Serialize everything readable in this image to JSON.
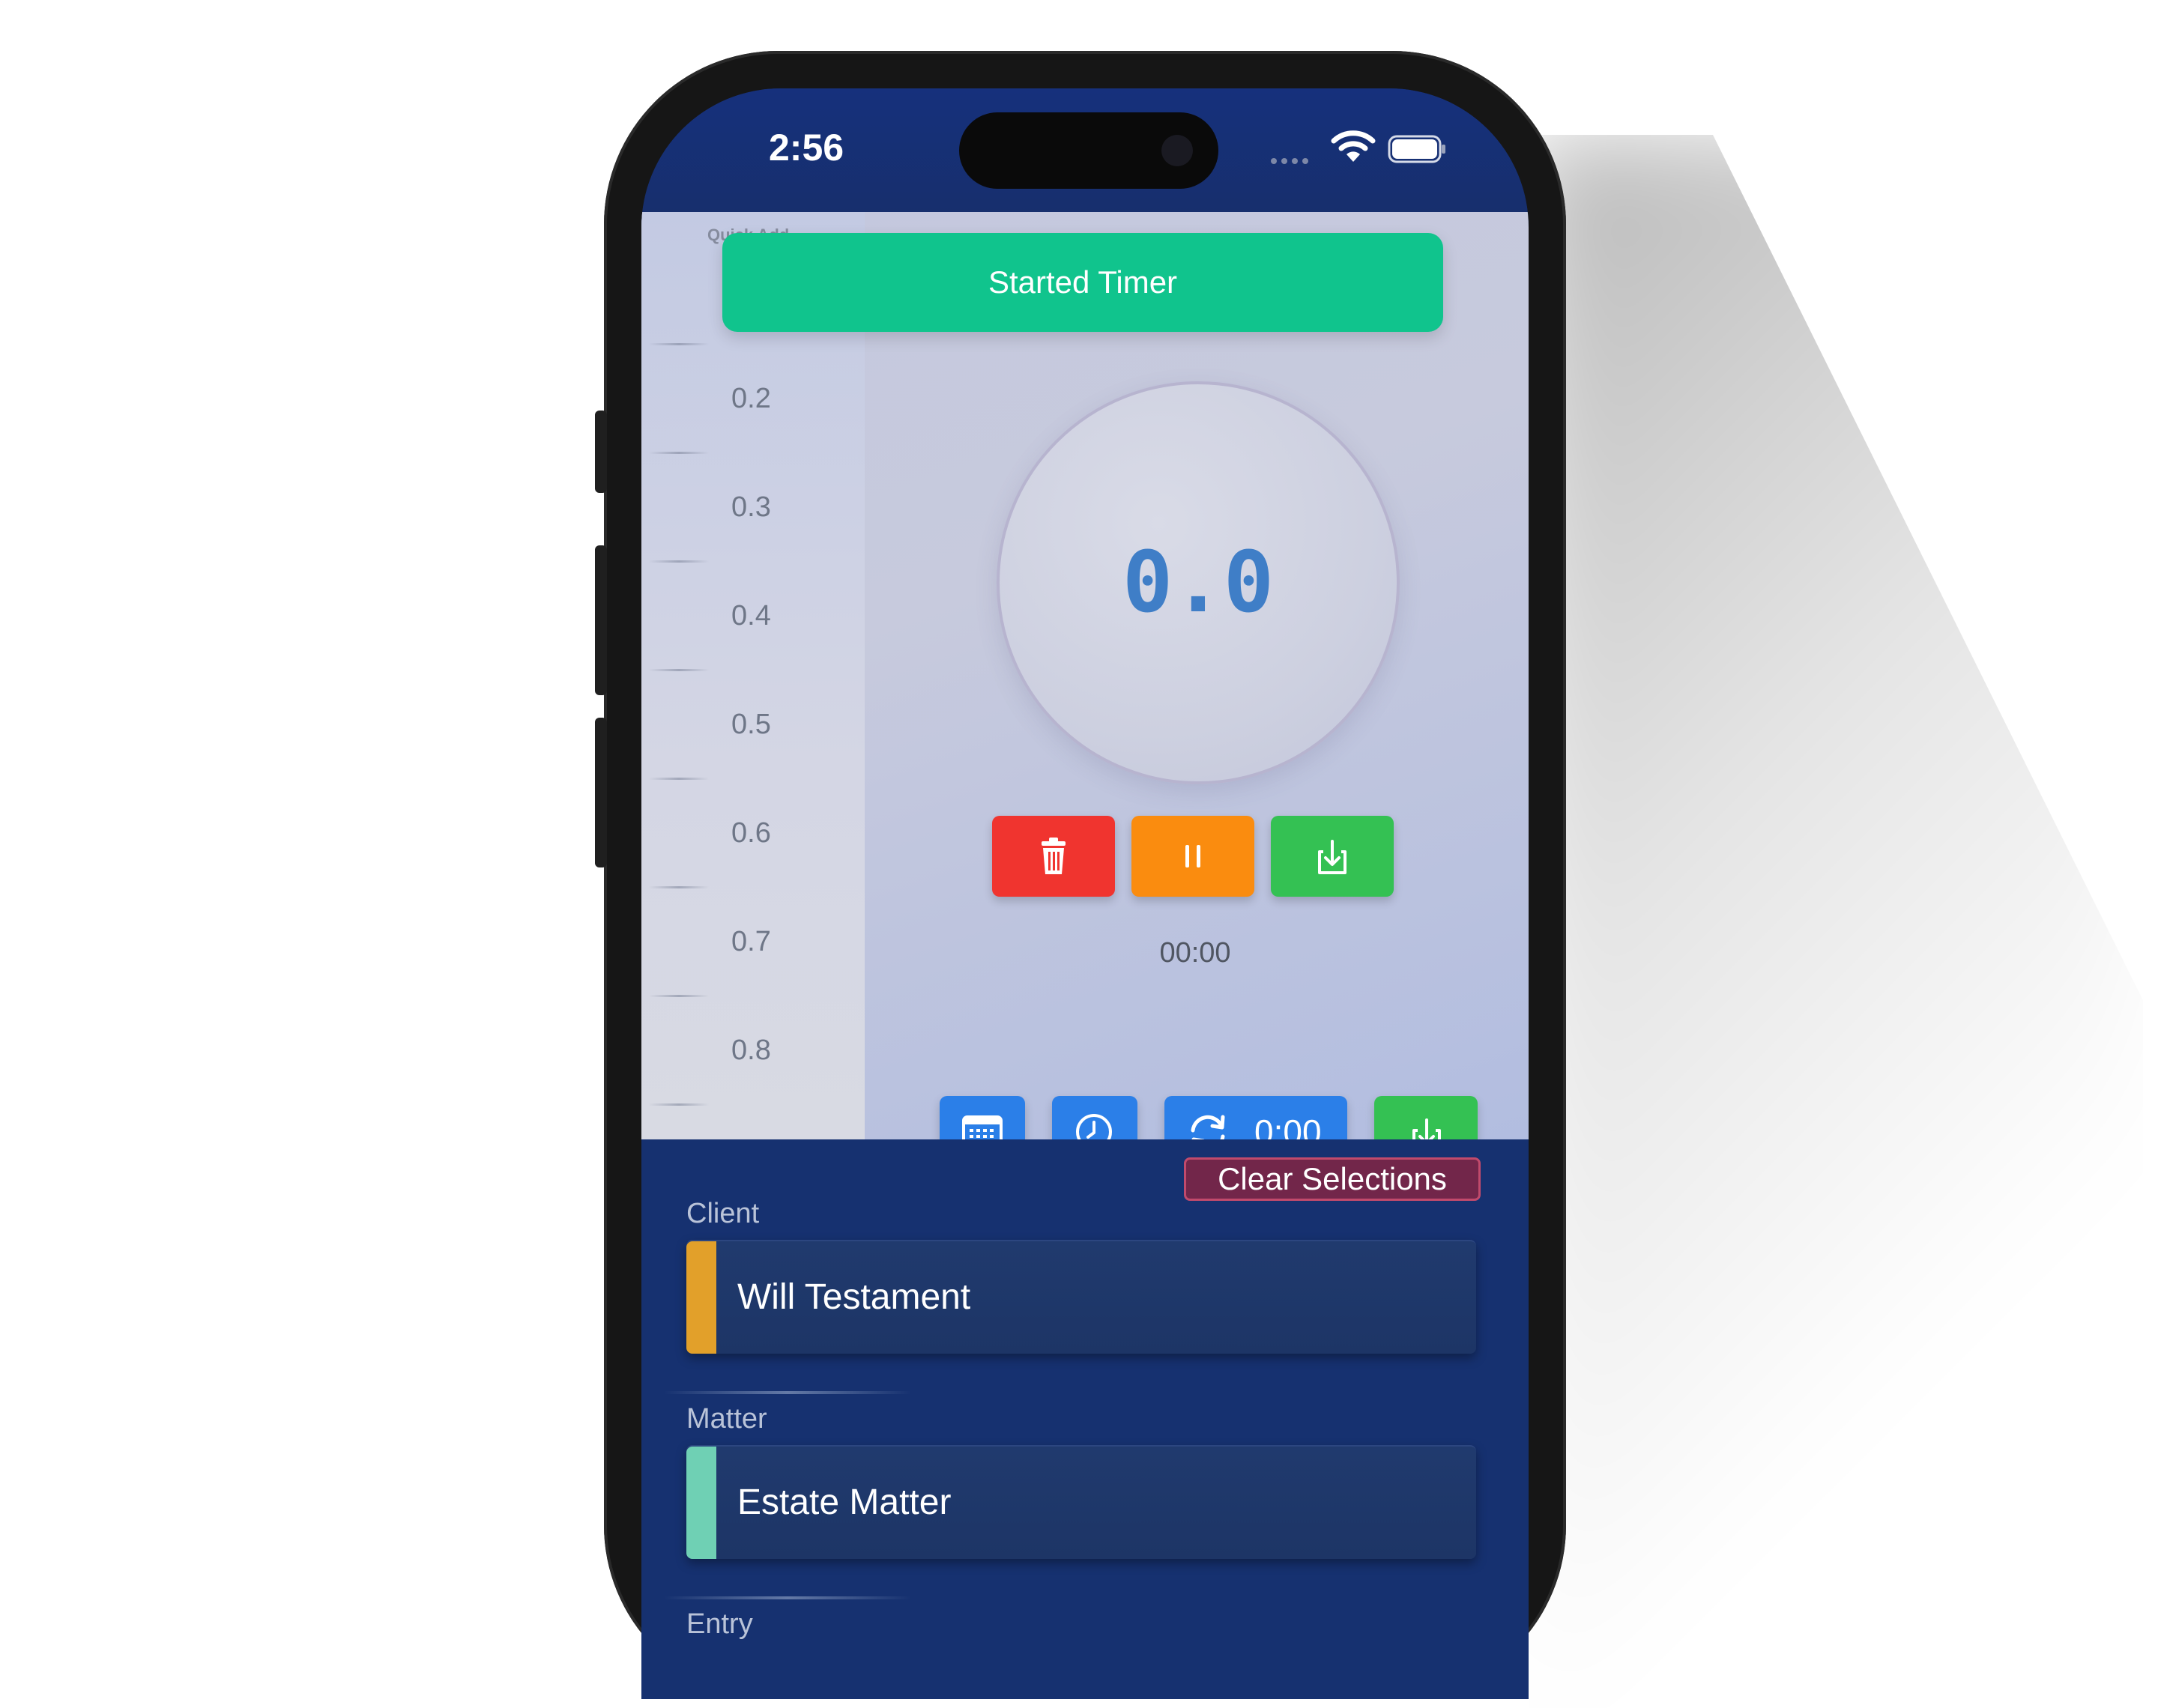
{
  "status_bar": {
    "time": "2:56"
  },
  "quick_add": {
    "title": "Quick Add",
    "values": [
      "0.2",
      "0.3",
      "0.4",
      "0.5",
      "0.6",
      "0.7",
      "0.8"
    ]
  },
  "toast": {
    "message": "Started Timer"
  },
  "timer": {
    "hours": "0.0",
    "elapsed": "00:00",
    "round_value": "0:00"
  },
  "controls": {
    "icons": [
      "trash-icon",
      "pause-icon",
      "save-icon"
    ],
    "colors": {
      "delete": "#f0342f",
      "pause": "#fa8c0f",
      "save": "#34c153",
      "action_blue": "#2b7fe8",
      "toast": "#10c48d"
    }
  },
  "form": {
    "clear_label": "Clear Selections",
    "client_label": "Client",
    "client_value": "Will Testament",
    "client_color": "#e2a02a",
    "matter_label": "Matter",
    "matter_value": "Estate Matter",
    "matter_color": "#6fd0b4",
    "entry_label": "Entry"
  }
}
